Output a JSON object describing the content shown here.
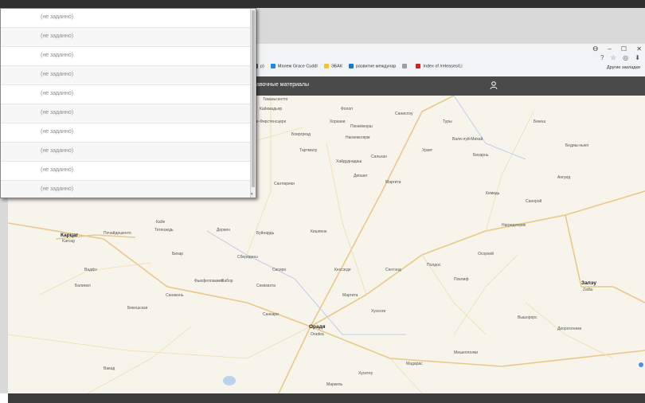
{
  "popup": {
    "rows": [
      "(не заданно)",
      "(не заданно)",
      "(не заданно)",
      "(не заданно)",
      "(не заданно)",
      "(не заданно)",
      "(не заданно)",
      "(не заданно)",
      "(не заданно)",
      "(не заданно)"
    ],
    "scroll_arrow": "▾"
  },
  "browser": {
    "window_controls": [
      "Ꝋ",
      "–",
      "☐",
      "✕"
    ],
    "address_icons": [
      "?",
      "☆",
      "◎",
      "⬇"
    ],
    "bookmarks": [
      {
        "label": "р)",
        "color": "#5f6368"
      },
      {
        "label": "Манеж Grace Cuddl",
        "color": "#1e88e5"
      },
      {
        "label": "ЭБАК",
        "color": "#fbc02d"
      },
      {
        "label": "развитие междунар",
        "color": "#1976d2"
      },
      {
        "label": "",
        "color": "#9e9e9e"
      },
      {
        "label": "Index of /releases/Li",
        "color": "#c62828"
      }
    ],
    "other_bookmarks": "Другие закладки"
  },
  "app": {
    "title": "авочные материалы"
  },
  "map": {
    "cities": [
      {
        "name": "Орадя",
        "sub": "Oradea"
      },
      {
        "name": "Залэу",
        "sub": "Zalău"
      },
      {
        "name": "Карцаг",
        "sub": "Karcag"
      }
    ],
    "labels": [
      "Тиканьсентто",
      "Кайхмадьяр",
      "Бюлльдыхенамарп",
      "Фолоп",
      "Хоркани",
      "Санислэу",
      "Туры",
      "Бенде-Фирстенсцерк",
      "Пюнкёкюрш",
      "Боиргрезд",
      "Нагиекюгярм",
      "Тартмалу",
      "Валя-луй-Михай",
      "Урзит",
      "Бихарнь",
      "Хайдуднадаш",
      "Сальхан",
      "Бихарфюред",
      "Сантюреки",
      "Диошег",
      "Маргита",
      "Пошеше",
      "Кимгик",
      "Кабе",
      "Тетензедь",
      "Почайдешенто",
      "Деркен",
      "Буйнардь",
      "Кишпенк",
      "Бихар",
      "Сбериденэ",
      "Сисиро",
      "Вабор",
      "Секизахта",
      "Кессэгде",
      "Сентэнд",
      "Полдос",
      "Вадфэ",
      "Балинкл",
      "Фьюфеллакиен",
      "Бекешская",
      "Санаконь",
      "Санкари",
      "Хусеоги",
      "Маргита",
      "Поклиф",
      "Осорхей",
      "Нагредлорик",
      "Санорой",
      "Ангуид",
      "Бедиш-ныеп",
      "Бекеш",
      "Кемедь",
      "Вышорорс",
      "Диоросенеке",
      "Мешеллолки",
      "Мадарас",
      "Хусетеу",
      "Маркель",
      "Вакад"
    ]
  }
}
